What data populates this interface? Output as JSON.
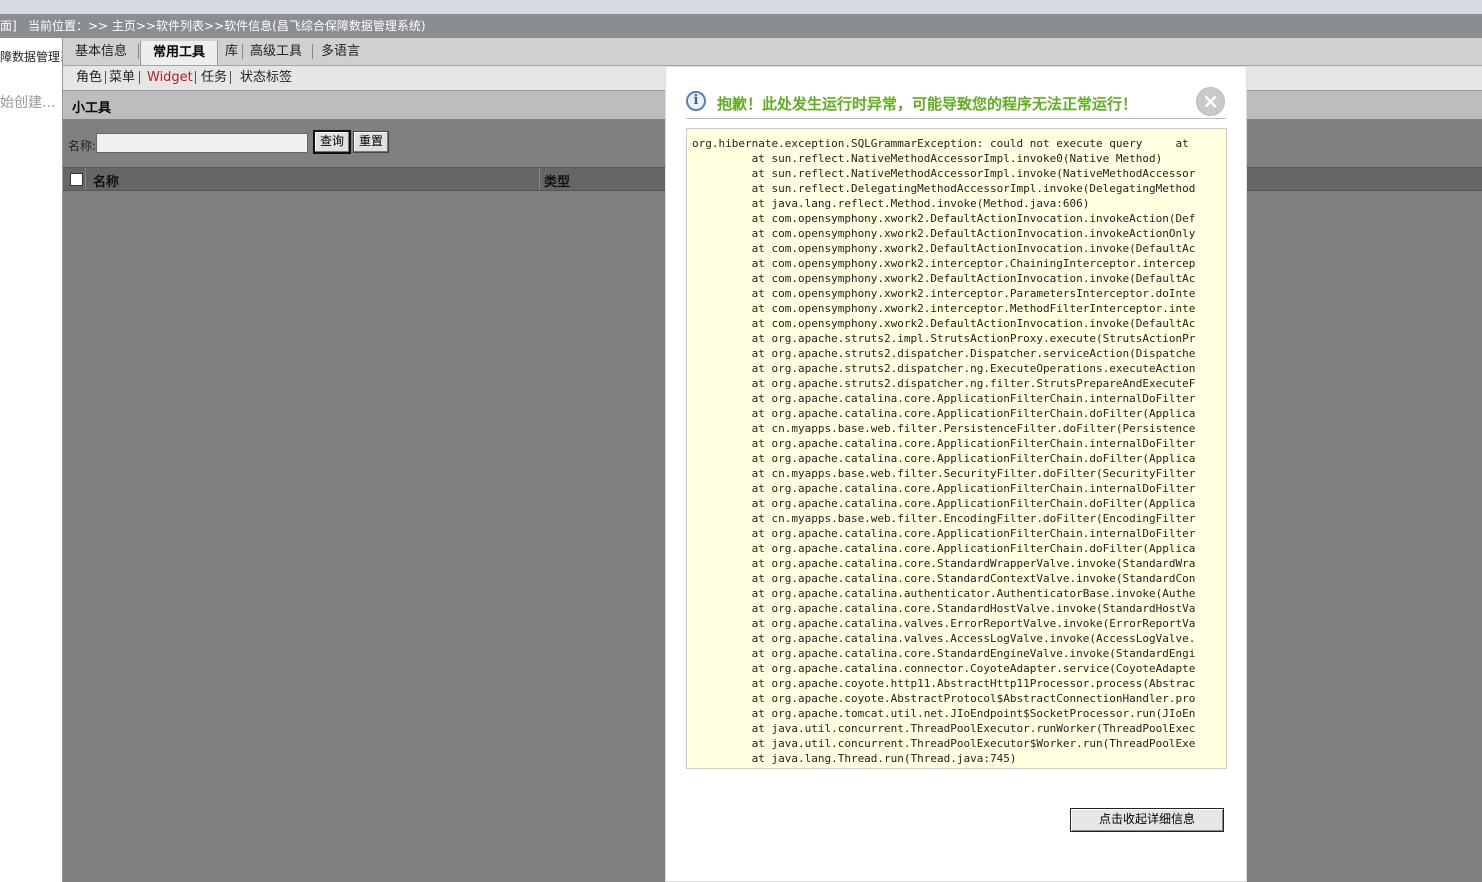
{
  "topbar": {
    "bracket": "面]",
    "location": "当前位置：>> 主页>>软件列表>>软件信息(昌飞综合保障数据管理系统)"
  },
  "sidebar": {
    "system_name": "障数据管理系",
    "creating_text": "始创建..."
  },
  "tabs": [
    "基本信息",
    "常用工具",
    "库",
    "高级工具",
    "多语言"
  ],
  "active_tab": "常用工具",
  "subtabs": [
    "角色",
    "菜单",
    "Widget",
    "任务",
    "状态标签"
  ],
  "active_subtab": "Widget",
  "section_title": "小工具",
  "search": {
    "label": "名称:",
    "value": "",
    "query_button": "查询",
    "reset_button": "重置"
  },
  "table": {
    "columns": [
      "名称",
      "类型"
    ]
  },
  "dialog": {
    "title": "抱歉！此处发生运行时异常，可能导致您的程序无法正常运行！",
    "close": "×",
    "collapse_button": "点击收起详细信息",
    "trace_lines": [
      "org.hibernate.exception.SQLGrammarException: could not execute query     at",
      "         at sun.reflect.NativeMethodAccessorImpl.invoke0(Native Method)",
      "         at sun.reflect.NativeMethodAccessorImpl.invoke(NativeMethodAccessor",
      "         at sun.reflect.DelegatingMethodAccessorImpl.invoke(DelegatingMethod",
      "         at java.lang.reflect.Method.invoke(Method.java:606)",
      "         at com.opensymphony.xwork2.DefaultActionInvocation.invokeAction(Def",
      "         at com.opensymphony.xwork2.DefaultActionInvocation.invokeActionOnly",
      "         at com.opensymphony.xwork2.DefaultActionInvocation.invoke(DefaultAc",
      "         at com.opensymphony.xwork2.interceptor.ChainingInterceptor.intercep",
      "         at com.opensymphony.xwork2.DefaultActionInvocation.invoke(DefaultAc",
      "         at com.opensymphony.xwork2.interceptor.ParametersInterceptor.doInte",
      "         at com.opensymphony.xwork2.interceptor.MethodFilterInterceptor.inte",
      "         at com.opensymphony.xwork2.DefaultActionInvocation.invoke(DefaultAc",
      "         at org.apache.struts2.impl.StrutsActionProxy.execute(StrutsActionPr",
      "         at org.apache.struts2.dispatcher.Dispatcher.serviceAction(Dispatche",
      "         at org.apache.struts2.dispatcher.ng.ExecuteOperations.executeAction",
      "         at org.apache.struts2.dispatcher.ng.filter.StrutsPrepareAndExecuteF",
      "         at org.apache.catalina.core.ApplicationFilterChain.internalDoFilter",
      "         at org.apache.catalina.core.ApplicationFilterChain.doFilter(Applica",
      "         at cn.myapps.base.web.filter.PersistenceFilter.doFilter(Persistence",
      "         at org.apache.catalina.core.ApplicationFilterChain.internalDoFilter",
      "         at org.apache.catalina.core.ApplicationFilterChain.doFilter(Applica",
      "         at cn.myapps.base.web.filter.SecurityFilter.doFilter(SecurityFilter",
      "         at org.apache.catalina.core.ApplicationFilterChain.internalDoFilter",
      "         at org.apache.catalina.core.ApplicationFilterChain.doFilter(Applica",
      "         at cn.myapps.base.web.filter.EncodingFilter.doFilter(EncodingFilter",
      "         at org.apache.catalina.core.ApplicationFilterChain.internalDoFilter",
      "         at org.apache.catalina.core.ApplicationFilterChain.doFilter(Applica",
      "         at org.apache.catalina.core.StandardWrapperValve.invoke(StandardWra",
      "         at org.apache.catalina.core.StandardContextValve.invoke(StandardCon",
      "         at org.apache.catalina.authenticator.AuthenticatorBase.invoke(Authe",
      "         at org.apache.catalina.core.StandardHostValve.invoke(StandardHostVa",
      "         at org.apache.catalina.valves.ErrorReportValve.invoke(ErrorReportVa",
      "         at org.apache.catalina.valves.AccessLogValve.invoke(AccessLogValve.",
      "         at org.apache.catalina.core.StandardEngineValve.invoke(StandardEngi",
      "         at org.apache.catalina.connector.CoyoteAdapter.service(CoyoteAdapte",
      "         at org.apache.coyote.http11.AbstractHttp11Processor.process(Abstrac",
      "         at org.apache.coyote.AbstractProtocol$AbstractConnectionHandler.pro",
      "         at org.apache.tomcat.util.net.JIoEndpoint$SocketProcessor.run(JIoEn",
      "         at java.util.concurrent.ThreadPoolExecutor.runWorker(ThreadPoolExec",
      "         at java.util.concurrent.ThreadPoolExecutor$Worker.run(ThreadPoolExe",
      "         at java.lang.Thread.run(Thread.java:745)"
    ]
  },
  "colors": {
    "title_green": "#5fae1e",
    "active_subtab_red": "#b22222",
    "trace_background": "#ffffe0",
    "overlay_gray": "#7f7f7f"
  }
}
